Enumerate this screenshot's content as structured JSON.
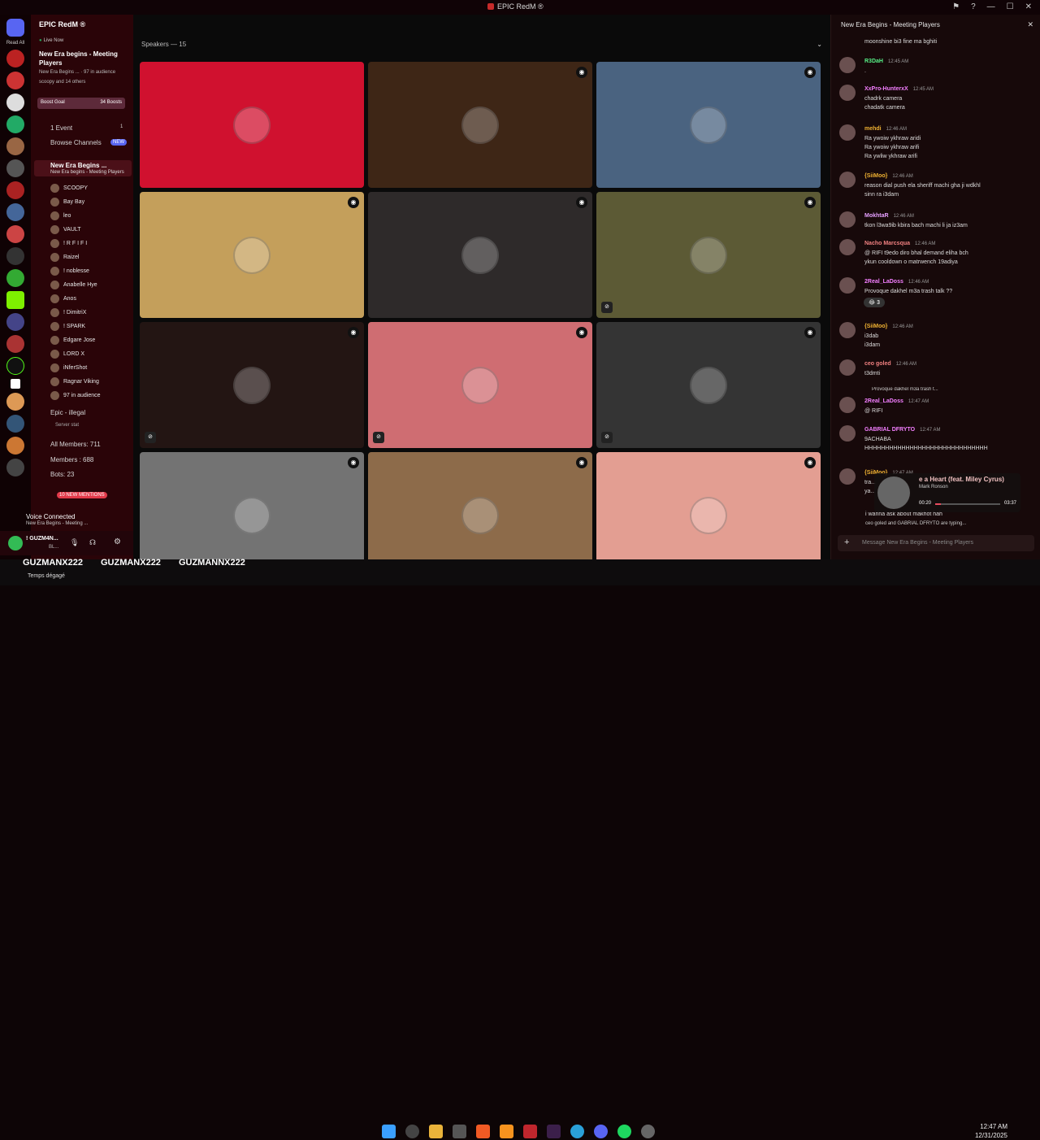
{
  "window": {
    "title": "EPIC RedM ®"
  },
  "server": {
    "name": "EPIC RedM ®",
    "live_label": "Live Now",
    "event_title": "New Era begins - Meeting Players",
    "event_sub": "New Era Begins ... · 97 in audience",
    "event_sub2": "scoopy and 14 others",
    "boost_goal": "Boost Goal",
    "boosts": "34 Boosts",
    "events_label": "1 Event",
    "events_count": "1",
    "browse_label": "Browse Channels",
    "browse_badge": "NEW",
    "voice_channel": "New Era Begins ...",
    "voice_sub": "New Era begins - Meeting Players",
    "members": [
      "SCOOPY",
      "Bay Bay",
      "leo",
      "VAULT",
      "! R F I F I",
      "Raizel",
      "! noblesse",
      "Anabelle Hye",
      "Anos",
      "! DimitriX",
      "! SPARK",
      "Edgare Jose",
      "LORD X",
      "iNferShot",
      "Ragnar Viking",
      "97 in audience"
    ],
    "text_channels": [
      "Epic - illegal",
      "Server stat",
      "All Members: 711",
      "Members : 688",
      "Bots: 23"
    ],
    "new_mentions": "10 NEW MENTIONS",
    "read_all": "Read All"
  },
  "voice": {
    "connected": "Voice Connected",
    "sub": "New Era Begins - Meeting ...",
    "user": "! GUZM4N...",
    "user_status": "BL..."
  },
  "stage": {
    "speakers_label": "Speakers — 15"
  },
  "tile_colors": [
    "#d0112f",
    "#3e2616",
    "#4a6380",
    "#c49f5b",
    "#2e2a2a",
    "#5c5a35",
    "#231513",
    "#cf6d72",
    "#343434",
    "#737373",
    "#8d6b4a",
    "#e39e92"
  ],
  "chat": {
    "header": "New Era Begins - Meeting Players",
    "messages": [
      {
        "name": "",
        "time": "",
        "text": "moonshine bi3 fine ma bghiti",
        "color": "#ddd"
      },
      {
        "name": "R3DaH",
        "time": "12:45 AM",
        "text": ".",
        "color": "#57f287"
      },
      {
        "name": "XxPro-HunterxX",
        "time": "12:45 AM",
        "text": "chadrk camera\nchadatk camera",
        "color": "#f47fff"
      },
      {
        "name": "mehdi",
        "time": "12:46 AM",
        "text": "Ra ywoiw ykhraw aridi\nRa ywoiw ykhraw arifi\nRa ywliw ykhraw arifi",
        "color": "#f0b232"
      },
      {
        "name": "{SiiMoo}",
        "time": "12:46 AM",
        "text": "reason dial push ela sheriff machi gha ji wdkhl\nsinn ra i3dam",
        "color": "#f0b232"
      },
      {
        "name": "MokhtaR",
        "time": "12:46 AM",
        "text": "tkon l3wa9ib kbira bach machi li ja iz3am",
        "color": "#e6a0ff"
      },
      {
        "name": "Nacho Marcsqua",
        "time": "12:46 AM",
        "text": "@ RIFI t9edo diro bhal demand eliha bch\nykun cooldown o matrwench 19adiya",
        "color": "#f08080"
      },
      {
        "name": "2Real_LaDoss",
        "time": "12:46 AM",
        "text": "Provoque dakhel m3a trash talk ??",
        "color": "#f47fff"
      },
      {
        "name": "{SiiMoo}",
        "time": "12:46 AM",
        "text": "i3dab\ni3dam",
        "color": "#f0b232"
      },
      {
        "name": "ceo goled",
        "time": "12:46 AM",
        "text": "t3dmti",
        "color": "#f08080"
      },
      {
        "name": "2Real_LaDoss",
        "time": "12:47 AM",
        "text": "@ RIFI",
        "color": "#f47fff"
      },
      {
        "name": "GABRIAL DFRYTO",
        "time": "12:47 AM",
        "text": "9ACHABA\nHHHHHHHHHHHHHHHHHHHHHHHHHHHHHH",
        "color": "#f47fff"
      },
      {
        "name": "{SiiMoo}",
        "time": "12:47 AM",
        "text": "tra...\nya...",
        "color": "#f0b232"
      }
    ],
    "reaction": "3",
    "reply_preview": "Provoque dakhel m3a trash t...",
    "last_line": "i wanna ask about makhot hah",
    "typing": "ceo goled and GABRIAL DFRYTO are typing...",
    "placeholder": "Message New Era Begins - Meeting Players"
  },
  "player": {
    "song": "e a Heart (feat. Miley Cyrus)",
    "artist": "Mark Ronson",
    "elapsed": "00:20",
    "total": "03:37",
    "progress": 0.09
  },
  "overlay": {
    "items": [
      "GUZMANX222",
      "GUZMANX222",
      "GUZMANNX222"
    ]
  },
  "weather": "Temps dégagé",
  "clock": {
    "time": "12:47 AM",
    "date": "12/31/2025"
  }
}
